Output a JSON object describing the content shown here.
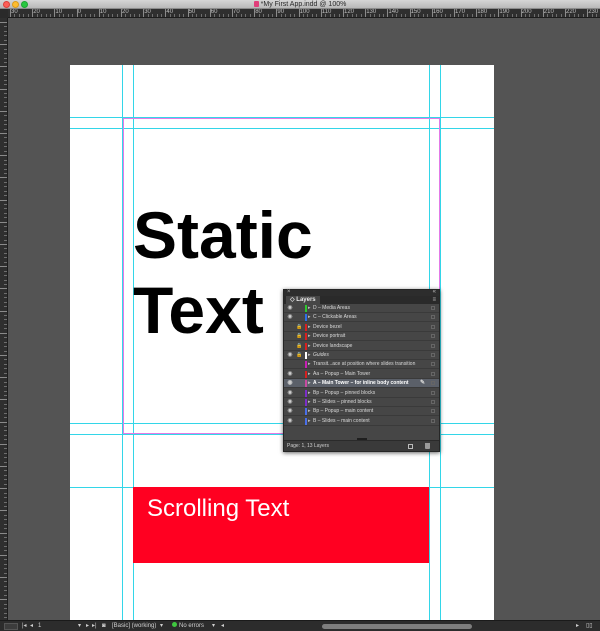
{
  "window": {
    "title": "*My First App.indd @ 100%"
  },
  "ruler": {
    "h_labels": [
      "30",
      "20",
      "10",
      "0",
      "10",
      "20",
      "30",
      "40",
      "50",
      "60",
      "70",
      "80",
      "90",
      "100",
      "110",
      "120",
      "130",
      "140",
      "150",
      "160",
      "170",
      "180",
      "190",
      "200",
      "210",
      "220",
      "230",
      "240"
    ]
  },
  "canvas": {
    "static_text_line1": "Static",
    "static_text_line2": "Text",
    "scrolling_text": "Scrolling Text",
    "scrolling_frame_color": "#ff0021",
    "guide_color": "#33d6e8",
    "margin_color": "#e47ae6"
  },
  "layers_panel": {
    "close_glyph": "×",
    "collapse_glyph": "«",
    "tab_label": "Layers",
    "menu_glyph": "≡",
    "layers": [
      {
        "name": "D – Media Areas",
        "color": "#2ec82e",
        "visible": true,
        "locked": false,
        "selected": false
      },
      {
        "name": "C – Clickable Areas",
        "color": "#2e6fe8",
        "visible": true,
        "locked": false,
        "selected": false
      },
      {
        "name": "Device bezel",
        "color": "#d82020",
        "visible": false,
        "locked": true,
        "selected": false
      },
      {
        "name": "Device portrait",
        "color": "#d82020",
        "visible": false,
        "locked": true,
        "selected": false
      },
      {
        "name": "Device landscape",
        "color": "#d82020",
        "visible": false,
        "locked": true,
        "selected": false
      },
      {
        "name": "Guides",
        "color": "#ffffff",
        "visible": true,
        "locked": true,
        "selected": false,
        "italic": true
      },
      {
        "name": "Transit...ace at position where slides transition",
        "color": "#c81eb4",
        "visible": false,
        "locked": false,
        "selected": false
      },
      {
        "name": "Aa – Popup – Main Tower",
        "color": "#d82020",
        "visible": true,
        "locked": false,
        "selected": false
      },
      {
        "name": "A – Main Tower – for inline body content",
        "color": "#c84aa0",
        "visible": true,
        "locked": false,
        "selected": true
      },
      {
        "name": "Bp – Popup – pinned blocks",
        "color": "#7b2ec8",
        "visible": true,
        "locked": false,
        "selected": false
      },
      {
        "name": "B – Slides – pinned blocks",
        "color": "#7b2ec8",
        "visible": true,
        "locked": false,
        "selected": false
      },
      {
        "name": "Bp – Popup – main content",
        "color": "#4a6fe8",
        "visible": true,
        "locked": false,
        "selected": false
      },
      {
        "name": "B – Slides – main content",
        "color": "#4a6fe8",
        "visible": true,
        "locked": false,
        "selected": false
      }
    ],
    "footer": "Page: 1, 13 Layers"
  },
  "statusbar": {
    "page_number": "1",
    "preflight_profile": "[Basic] (working)",
    "preflight_status": "No errors"
  }
}
